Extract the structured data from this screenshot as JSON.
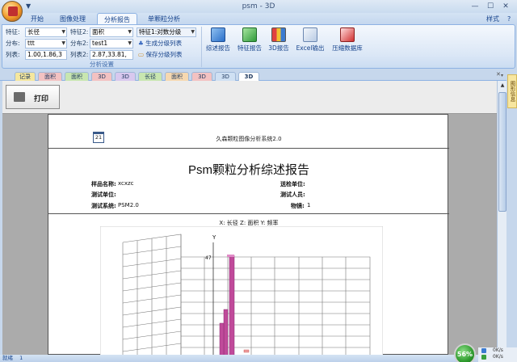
{
  "window": {
    "title": "psm - 3D",
    "qa_glyph": "▼"
  },
  "window_buttons": {
    "minimize": "—",
    "maximize": "☐",
    "close": "✕"
  },
  "tabs": [
    {
      "label": "开始"
    },
    {
      "label": "图像处理"
    },
    {
      "label": "分析报告"
    },
    {
      "label": "单颗粒分析"
    }
  ],
  "style_menu": {
    "label": "样式",
    "help_glyph": "?"
  },
  "ribbon": {
    "feature_label": "特征:",
    "feature_value": "长径",
    "distribution_label": "分布:",
    "distribution_value": "ttt",
    "list_label": "列表:",
    "list_value": "1.00,1.86,3",
    "feature2_label": "特征2:",
    "feature2_value": "面积",
    "distribution2_label": "分布2:",
    "distribution2_value": "test1",
    "list2_label": "列表2:",
    "list2_value": "2.87,33.81,",
    "feature1_class": "特征1:对数分级",
    "generate_list": "生成分级列表",
    "save_list": "保存分级列表",
    "group_label": "分析设置",
    "buttons": {
      "summary": "综述报告",
      "feature": "特征报告",
      "report3d": "3D报告",
      "excel": "Excel输出",
      "compress": "压缩数据库"
    }
  },
  "doc_tabs": [
    {
      "label": "记录",
      "color": "#f5e79e"
    },
    {
      "label": "面积",
      "color": "#f3c2c2"
    },
    {
      "label": "面积",
      "color": "#c8e6b0"
    },
    {
      "label": "3D",
      "color": "#f3c2c2"
    },
    {
      "label": "3D",
      "color": "#d8c8ee"
    },
    {
      "label": "长径",
      "color": "#c8e6b0"
    },
    {
      "label": "面积",
      "color": "#f6d8b0"
    },
    {
      "label": "3D",
      "color": "#f3c2c2"
    },
    {
      "label": "3D",
      "color": "#cfe0f3"
    },
    {
      "label": "3D",
      "color": "#ffffff"
    }
  ],
  "doc_tab_close": "✕",
  "print_button": "打印",
  "report": {
    "calendar_day": "21",
    "system_name": "久森颗粒图像分析系统2.0",
    "title": "Psm颗粒分析综述报告",
    "sample_name_label": "样品名称:",
    "sample_name_value": "xcxzc",
    "send_unit_label": "送检单位:",
    "send_unit_value": "",
    "test_unit_label": "测试单位:",
    "test_unit_value": "",
    "tester_label": "测试人员:",
    "tester_value": "",
    "test_system_label": "测试系统:",
    "test_system_value": "PSM2.0",
    "magnification_label": "物镜:",
    "magnification_value": "1",
    "chart_caption": "X: 长径 Z: 面积 Y: 频率",
    "y_axis_label": "Y",
    "y_max_tick": "47"
  },
  "side_pane_label": "图形信息",
  "status": {
    "text": "就绪",
    "count": "1"
  },
  "gauge": {
    "value": "56%"
  },
  "net": {
    "up": "0K/s",
    "down": "0K/s"
  },
  "colors": {
    "accent": "#15428b",
    "bar": "#c04a9a",
    "bar_dark": "#8a2a70"
  }
}
